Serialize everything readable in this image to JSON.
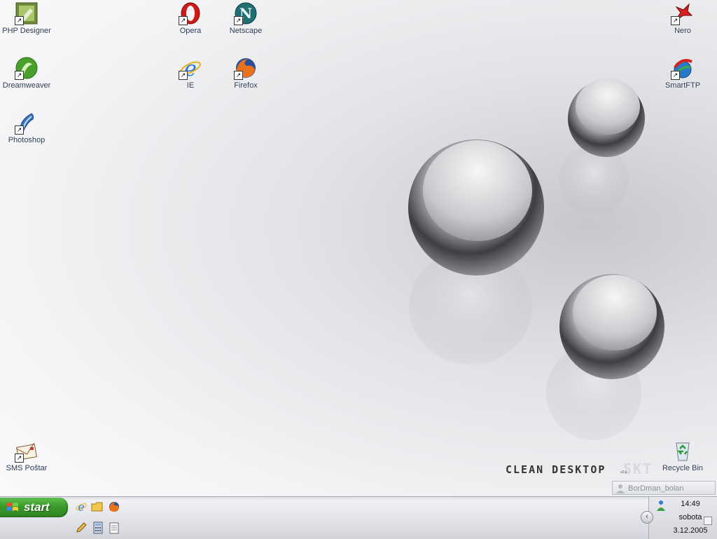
{
  "desktop": {
    "icons": [
      {
        "label": "PHP Designer",
        "icon": "php-designer-icon"
      },
      {
        "label": "Dreamweaver",
        "icon": "dreamweaver-icon"
      },
      {
        "label": "Photoshop",
        "icon": "photoshop-icon"
      },
      {
        "label": "Opera",
        "icon": "opera-icon"
      },
      {
        "label": "Netscape",
        "icon": "netscape-icon"
      },
      {
        "label": "IE",
        "icon": "internet-explorer-icon"
      },
      {
        "label": "Firefox",
        "icon": "firefox-icon"
      },
      {
        "label": "Nero",
        "icon": "nero-icon"
      },
      {
        "label": "SmartFTP",
        "icon": "smartftp-icon"
      },
      {
        "label": "SMS Poštar",
        "icon": "sms-postar-icon"
      },
      {
        "label": "Recycle Bin",
        "icon": "recycle-bin-icon"
      }
    ],
    "wallpaper_brand": "CLEAN DESKTOP",
    "wallpaper_brand_ghost": "SKT",
    "wallpaper_version": "v2.0",
    "user_bar_text": "BorDman_bolan"
  },
  "taskbar": {
    "start_label": "start",
    "quick_launch": [
      "ie-icon",
      "folder-icon",
      "firefox-icon",
      "pencil-icon",
      "calculator-icon",
      "notepad-icon"
    ],
    "tray": {
      "time": "14:49",
      "day": "sobota",
      "date": "3.12.2005",
      "expand_symbol": "‹"
    }
  },
  "colors": {
    "start_green": "#3a9a2a",
    "label_text": "#2b3a55"
  }
}
